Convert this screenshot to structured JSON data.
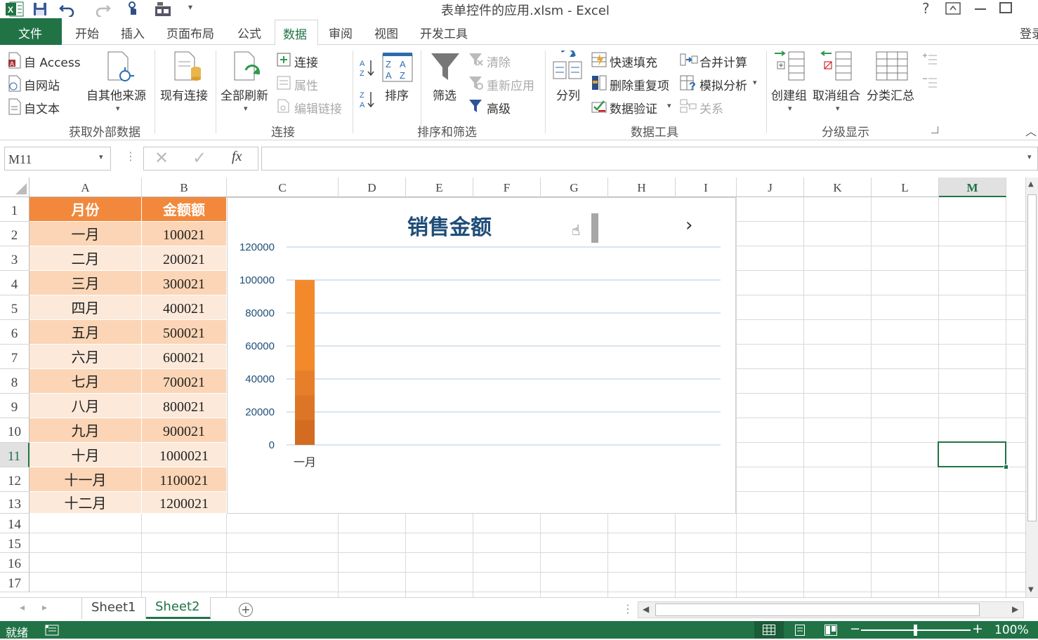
{
  "title": "表单控件的应用.xlsm - Excel",
  "titlebar_icons": [
    "excel-logo-icon",
    "save-icon",
    "undo-icon",
    "redo-icon",
    "touch-mode-icon",
    "form-control-icon",
    "customize-qat-icon"
  ],
  "window_buttons": {
    "help": "?"
  },
  "tabs": {
    "file": "文件",
    "items": [
      "开始",
      "插入",
      "页面布局",
      "公式",
      "数据",
      "审阅",
      "视图",
      "开发工具"
    ],
    "active": "数据",
    "login": "登录"
  },
  "ribbon": {
    "external": {
      "access": "自 Access",
      "web": "自网站",
      "text": "自文本",
      "other": "自其他来源",
      "existing": "现有连接",
      "group": "获取外部数据"
    },
    "connections": {
      "refresh": "全部刷新",
      "connect": "连接",
      "props": "属性",
      "edit_links": "编辑链接",
      "group": "连接"
    },
    "sort": {
      "sort": "排序",
      "filter": "筛选",
      "clear": "清除",
      "reapply": "重新应用",
      "advanced": "高级",
      "group": "排序和筛选"
    },
    "tools": {
      "split": "分列",
      "flash": "快速填充",
      "dedupe": "删除重复项",
      "validate": "数据验证",
      "consolidate": "合并计算",
      "whatif": "模拟分析",
      "relations": "关系",
      "group": "数据工具"
    },
    "outline": {
      "group_btn": "创建组",
      "ungroup": "取消组合",
      "subtotal": "分类汇总",
      "group": "分级显示"
    }
  },
  "formula_bar": {
    "name_box": "M11",
    "fx": "fx",
    "value": ""
  },
  "columns": [
    "A",
    "B",
    "C",
    "D",
    "E",
    "F",
    "G",
    "H",
    "I",
    "J",
    "K",
    "L",
    "M"
  ],
  "active_column": "M",
  "rows": [
    "1",
    "2",
    "3",
    "4",
    "5",
    "6",
    "7",
    "8",
    "9",
    "10",
    "11",
    "12",
    "13",
    "14",
    "15",
    "16",
    "17"
  ],
  "active_row": "11",
  "table": {
    "headers": [
      "月份",
      "金额额"
    ],
    "rows": [
      [
        "一月",
        "100021"
      ],
      [
        "二月",
        "200021"
      ],
      [
        "三月",
        "300021"
      ],
      [
        "四月",
        "400021"
      ],
      [
        "五月",
        "500021"
      ],
      [
        "六月",
        "600021"
      ],
      [
        "七月",
        "700021"
      ],
      [
        "八月",
        "800021"
      ],
      [
        "九月",
        "900021"
      ],
      [
        "十月",
        "1000021"
      ],
      [
        "十一月",
        "1100021"
      ],
      [
        "十二月",
        "1200021"
      ]
    ]
  },
  "chart_data": {
    "type": "bar",
    "title": "销售金额",
    "categories": [
      "一月"
    ],
    "values": [
      100000
    ],
    "ylim": [
      0,
      120000
    ],
    "yticks": [
      "120000",
      "100000",
      "80000",
      "60000",
      "40000",
      "20000",
      "0"
    ],
    "grid": true,
    "bar_color": "#f28a2c",
    "nav_next": "›"
  },
  "sheets": [
    "Sheet1",
    "Sheet2"
  ],
  "active_sheet": "Sheet2",
  "status": {
    "ready": "就绪",
    "zoom": "100%"
  },
  "colors": {
    "accent": "#217346",
    "header": "#f2883b",
    "row_light": "#fde9d9",
    "row_dark": "#fbd5b5"
  }
}
